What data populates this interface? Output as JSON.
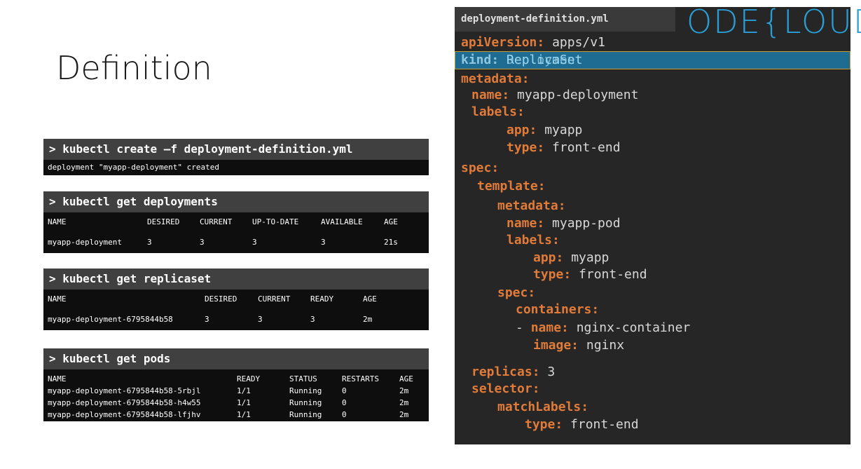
{
  "slide": {
    "title": "Definition"
  },
  "logo": {
    "text": "ODE{LOUD"
  },
  "terminals": {
    "create": {
      "command": "> kubectl create –f deployment-definition.yml",
      "output": "deployment \"myapp-deployment\" created"
    },
    "deployments": {
      "command": "> kubectl get deployments",
      "headers": [
        "NAME",
        "DESIRED",
        "CURRENT",
        "UP-TO-DATE",
        "AVAILABLE",
        "AGE"
      ],
      "rows": [
        [
          "myapp-deployment",
          "3",
          "3",
          "3",
          "3",
          "21s"
        ]
      ]
    },
    "replicaset": {
      "command": "> kubectl get replicaset",
      "headers": [
        "NAME",
        "DESIRED",
        "CURRENT",
        "READY",
        "AGE"
      ],
      "rows": [
        [
          "myapp-deployment-6795844b58",
          "3",
          "3",
          "3",
          "2m"
        ]
      ]
    },
    "pods": {
      "command": "> kubectl get pods",
      "headers": [
        "NAME",
        "READY",
        "STATUS",
        "RESTARTS",
        "AGE"
      ],
      "rows": [
        [
          "myapp-deployment-6795844b58-5rbjl",
          "1/1",
          "Running",
          "0",
          "2m"
        ],
        [
          "myapp-deployment-6795844b58-h4w55",
          "1/1",
          "Running",
          "0",
          "2m"
        ],
        [
          "myapp-deployment-6795844b58-lfjhv",
          "1/1",
          "Running",
          "0",
          "2m"
        ]
      ]
    }
  },
  "yaml": {
    "filename": "deployment-definition.yml",
    "apiVersion_key": "apiVersion:",
    "apiVersion_val": "apps/v1",
    "kind_key": "kind:",
    "kind_val": "ReplicaSet",
    "kind_val_new": "Deployment",
    "metadata_key": "metadata:",
    "name_key": "name:",
    "name_val": "myapp-deployment",
    "labels_key": "labels:",
    "app_key": "app:",
    "app_val": "myapp",
    "type_key": "type:",
    "type_val": "front-end",
    "spec_key": "spec:",
    "template_key": "template:",
    "tmeta_key": "metadata:",
    "tname_key": "name:",
    "tname_val": "myapp-pod",
    "tlabels_key": "labels:",
    "tapp_key": "app:",
    "tapp_val": "myapp",
    "ttype_key": "type:",
    "ttype_val": "front-end",
    "tspec_key": "spec:",
    "containers_key": "containers:",
    "cname_dash": "- ",
    "cname_key": "name:",
    "cname_val": "nginx-container",
    "image_key": "image:",
    "image_val": "nginx",
    "replicas_key": "replicas:",
    "replicas_val": "3",
    "selector_key": "selector:",
    "matchLabels_key": "matchLabels:",
    "mtype_key": "type:",
    "mtype_val": "front-end"
  },
  "colors": {
    "yaml_key": "#e07b39",
    "highlight": "#1f6c93",
    "logo": "#2a9fd6"
  }
}
